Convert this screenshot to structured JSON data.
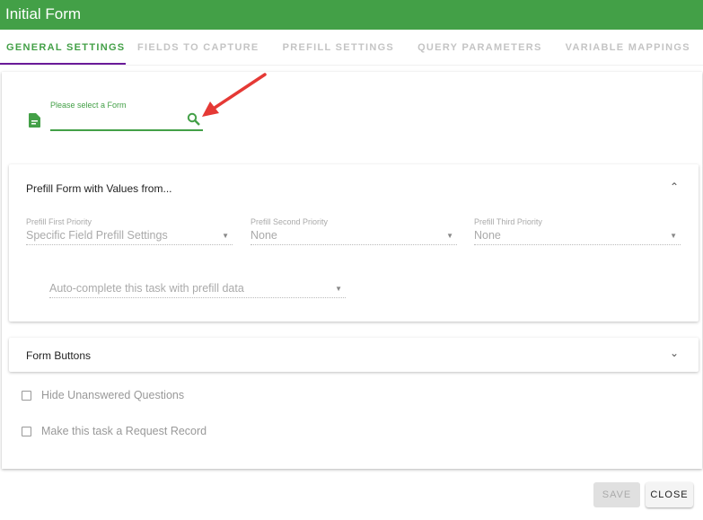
{
  "header": {
    "title": "Initial Form"
  },
  "tabs": [
    {
      "label": "GENERAL SETTINGS"
    },
    {
      "label": "FIELDS TO CAPTURE"
    },
    {
      "label": "PREFILL SETTINGS"
    },
    {
      "label": "QUERY PARAMETERS"
    },
    {
      "label": "VARIABLE MAPPINGS"
    }
  ],
  "form_select": {
    "label": "Please select a Form",
    "value": ""
  },
  "prefill": {
    "title": "Prefill Form with Values from...",
    "selects": [
      {
        "label": "Prefill First Priority",
        "value": "Specific Field Prefill Settings"
      },
      {
        "label": "Prefill Second Priority",
        "value": "None"
      },
      {
        "label": "Prefill Third Priority",
        "value": "None"
      }
    ],
    "autocomplete": {
      "placeholder": "Auto-complete this task with prefill data"
    }
  },
  "form_buttons": {
    "title": "Form Buttons"
  },
  "checkboxes": [
    {
      "label": "Hide Unanswered Questions",
      "checked": false
    },
    {
      "label": "Make this task a Request Record",
      "checked": false
    }
  ],
  "footer": {
    "save": "SAVE",
    "close": "CLOSE"
  },
  "colors": {
    "primary": "#43a047",
    "tab_indicator": "#6a1b9a",
    "annotation_arrow": "#e53935"
  }
}
